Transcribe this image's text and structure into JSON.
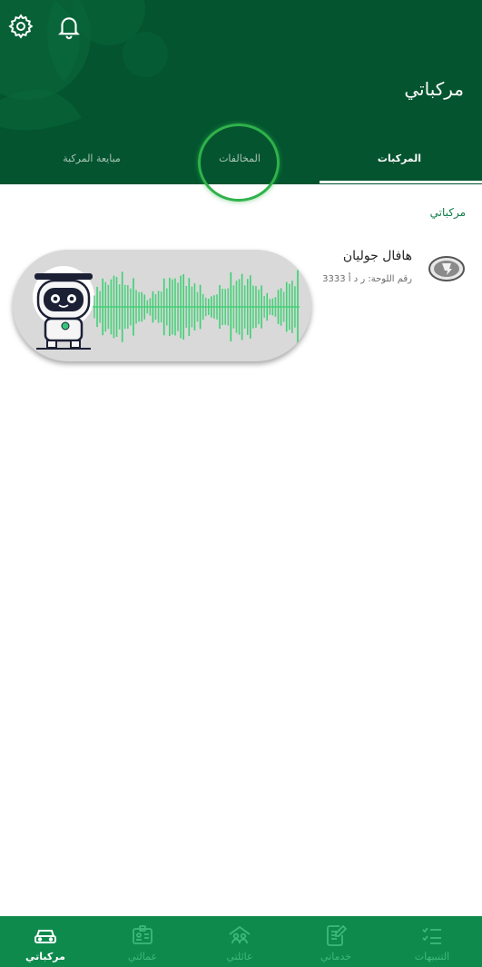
{
  "header": {
    "title": "مركباتي",
    "settings_icon": "gear-icon",
    "notifications_icon": "bell-icon"
  },
  "tabs": [
    {
      "label": "المركبات",
      "active": true
    },
    {
      "label": "المخالفات",
      "active": false
    },
    {
      "label": "مبايعة المركبة",
      "active": false
    }
  ],
  "section": {
    "label": "مركباتي"
  },
  "vehicle": {
    "name": "هافال جوليان",
    "plate": "رقم اللوحة: ر د أ 3333",
    "logo_icon": "car-brand-logo-icon"
  },
  "assistant": {
    "avatar_icon": "robot-assistant-icon",
    "wave_icon": "voice-waveform-icon"
  },
  "bottom_nav": [
    {
      "label": "مركباتي",
      "icon": "car-icon",
      "active": true
    },
    {
      "label": "عمالتي",
      "icon": "id-card-icon",
      "active": false
    },
    {
      "label": "عائلتي",
      "icon": "family-icon",
      "active": false
    },
    {
      "label": "خدماتي",
      "icon": "edit-document-icon",
      "active": false
    },
    {
      "label": "التنبيهات",
      "icon": "checklist-icon",
      "active": false
    }
  ],
  "colors": {
    "header_bg": "#03542f",
    "bottom_nav_bg": "#0e8a4d",
    "accent": "#2fb24a",
    "section_label": "#0e7a49"
  }
}
